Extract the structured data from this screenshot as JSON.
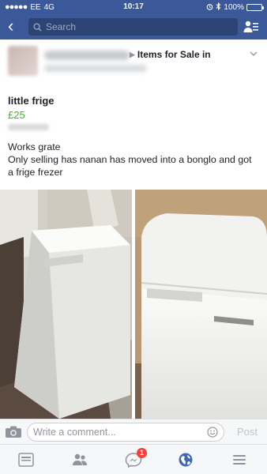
{
  "status_bar": {
    "carrier": "EE",
    "network": "4G",
    "time": "10:17",
    "battery": "100%"
  },
  "nav": {
    "search_placeholder": "Search"
  },
  "post": {
    "group_link": "Items for Sale in",
    "title": "little frige",
    "price": "£25",
    "description_line1": "Works grate",
    "description_line2": "Only selling has nanan has moved into a bonglo and got a frige frezer"
  },
  "comment_bar": {
    "placeholder": "Write a comment...",
    "post_label": "Post"
  },
  "tab_bar": {
    "messages_badge": "1"
  },
  "colors": {
    "brand": "#3b5998",
    "price": "#42b72a",
    "badge": "#fa3e3e"
  }
}
